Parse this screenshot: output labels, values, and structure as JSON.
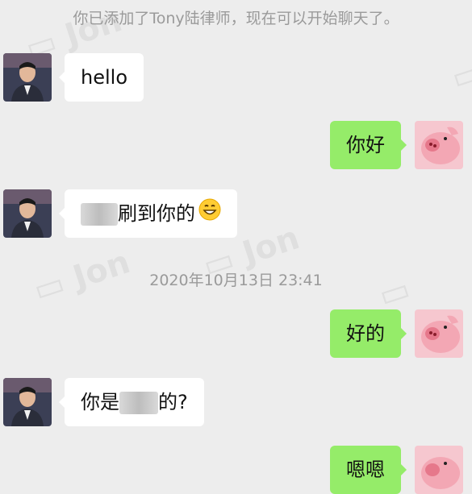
{
  "system_message": "你已添加了Tony陆律师，现在可以开始聊天了。",
  "timestamp": "2020年10月13日 23:41",
  "messages": [
    {
      "side": "left",
      "text": "hello"
    },
    {
      "side": "right",
      "text": "你好"
    },
    {
      "side": "left",
      "text_before": "",
      "text_after": "刷到你的",
      "emoji": "grinning-face"
    },
    {
      "side": "right",
      "text": "好的"
    },
    {
      "side": "left",
      "text_before": "你是",
      "text_after": "的?"
    },
    {
      "side": "right",
      "text": "嗯嗯"
    }
  ],
  "colors": {
    "background": "#ededed",
    "left_bubble": "#ffffff",
    "right_bubble": "#95ec69",
    "system_text": "#9a9a9a"
  }
}
